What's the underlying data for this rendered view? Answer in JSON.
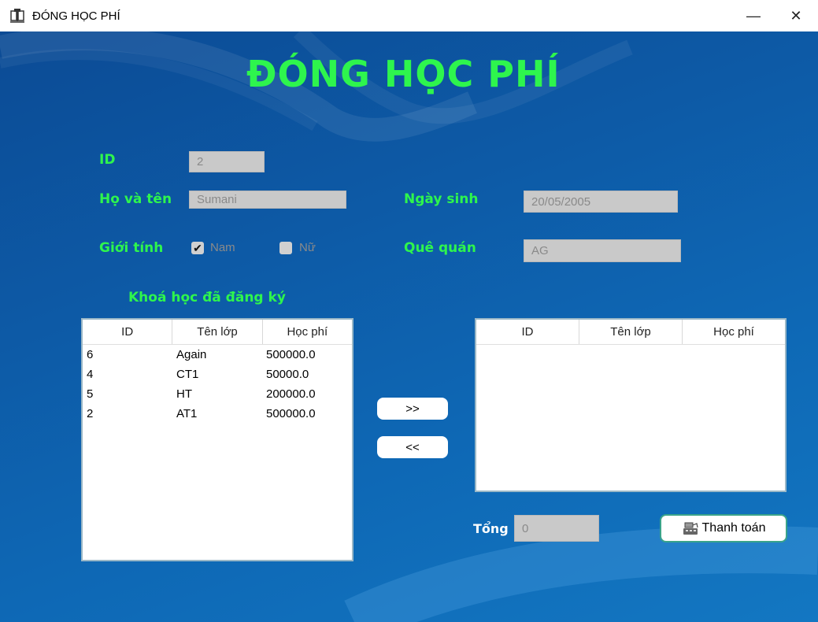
{
  "window": {
    "title": "ĐÓNG HỌC PHÍ",
    "minimize": "—",
    "close": "✕"
  },
  "heading": "ĐÓNG HỌC PHÍ",
  "form": {
    "id_label": "ID",
    "id_value": "2",
    "name_label": "Họ và tên",
    "name_value": "Sumani",
    "dob_label": "Ngày sinh",
    "dob_value": "20/05/2005",
    "gender_label": "Giới tính",
    "male_label": "Nam",
    "male_checked": true,
    "female_label": "Nữ",
    "female_checked": false,
    "hometown_label": "Quê quán",
    "hometown_value": "AG"
  },
  "registered": {
    "title": "Khoá học đã đăng ký",
    "columns": [
      "ID",
      "Tên lớp",
      "Học phí"
    ],
    "rows": [
      [
        "6",
        "Again",
        "500000.0"
      ],
      [
        "4",
        "CT1",
        "50000.0"
      ],
      [
        "5",
        "HT",
        "200000.0"
      ],
      [
        "2",
        "AT1",
        "500000.0"
      ]
    ]
  },
  "selected": {
    "columns": [
      "ID",
      "Tên lớp",
      "Học phí"
    ],
    "rows": []
  },
  "buttons": {
    "add": ">>",
    "remove": "<<",
    "pay": "Thanh toán"
  },
  "total": {
    "label": "Tổng",
    "value": "0"
  },
  "colors": {
    "accent": "#2ef54d",
    "background": "#0d5aa6",
    "pay_border": "#3aa48a"
  }
}
